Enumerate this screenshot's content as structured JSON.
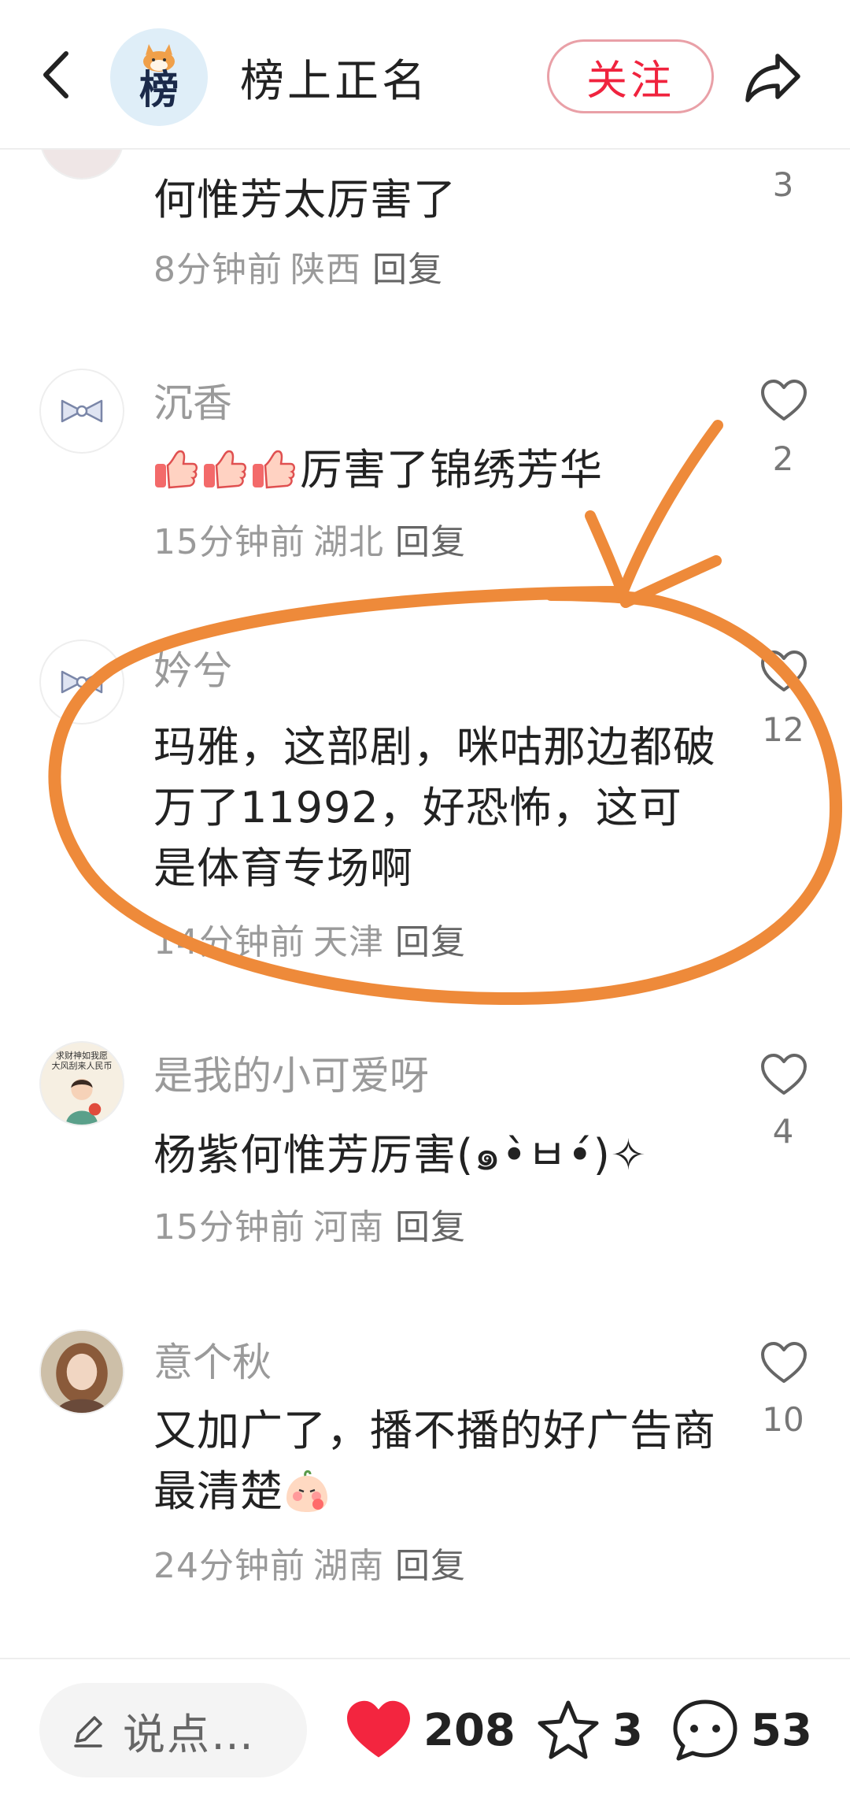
{
  "header": {
    "logo_text": "榜",
    "title": "榜上正名",
    "follow_label": "关注"
  },
  "comments": [
    {
      "name": "",
      "text": "何惟芳太厉害了",
      "time": "8分钟前",
      "location": "陕西",
      "reply": "回复",
      "likes": "3"
    },
    {
      "name": "沉香",
      "text": "厉害了锦绣芳华",
      "emoji_prefix": [
        "thumbs-up",
        "thumbs-up",
        "thumbs-up"
      ],
      "time": "15分钟前",
      "location": "湖北",
      "reply": "回复",
      "likes": "2"
    },
    {
      "name": "妗兮",
      "text": "玛雅，这部剧，咪咕那边都破万了11992，好恐怖，这可是体育专场啊",
      "time": "14分钟前",
      "location": "天津",
      "reply": "回复",
      "likes": "12"
    },
    {
      "name": "是我的小可爱呀",
      "text": "杨紫何惟芳厉害(๑•̀ㅂ•́)✧",
      "avatar_caption_1": "求财神如我愿",
      "avatar_caption_2": "大风刮来人民币",
      "time": "15分钟前",
      "location": "河南",
      "reply": "回复",
      "likes": "4"
    },
    {
      "name": "意个秋",
      "text": "又加广了，播不播的好广告商最清楚",
      "time": "24分钟前",
      "location": "湖南",
      "reply": "回复",
      "likes": "10"
    }
  ],
  "bottom_bar": {
    "input_placeholder": "说点…",
    "likes": "208",
    "stars": "3",
    "comments": "53"
  },
  "colors": {
    "accent_red": "#f0233e",
    "annotation_orange": "#ee8a3a",
    "muted_text": "#9a9a9a"
  }
}
